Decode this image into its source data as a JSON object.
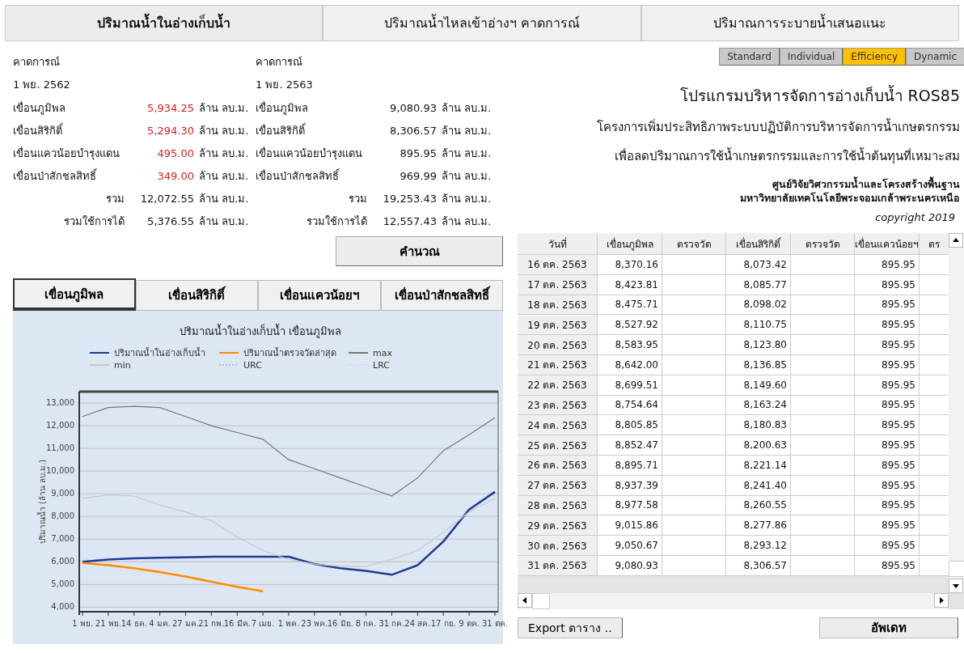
{
  "top_tabs": [
    {
      "label": "ปริมาณน้ำในอ่างเก็บน้ำ",
      "selected": true
    },
    {
      "label": "ปริมาณน้ำไหลเข้าอ่างฯ คาดการณ์",
      "selected": false
    },
    {
      "label": "ปริมาณการระบายน้ำเสนอแนะ",
      "selected": false
    }
  ],
  "forecasts": [
    {
      "heading": "คาดการณ์",
      "date": "1 พย. 2562",
      "dams": [
        {
          "name": "เขื่อนภูมิพล",
          "value": "5,934.25",
          "unit": "ล้าน ลบ.ม.",
          "highlight": true
        },
        {
          "name": "เขื่อนสิริกิติ์",
          "value": "5,294.30",
          "unit": "ล้าน ลบ.ม.",
          "highlight": true
        },
        {
          "name": "เขื่อนแควน้อยบำรุงแดน",
          "value": "495.00",
          "unit": "ล้าน ลบ.ม.",
          "highlight": true
        },
        {
          "name": "เขื่อนป่าสักชลสิทธิ์",
          "value": "349.00",
          "unit": "ล้าน ลบ.ม.",
          "highlight": true
        }
      ],
      "totals": [
        {
          "label": "รวม",
          "value": "12,072.55",
          "unit": "ล้าน ลบ.ม."
        },
        {
          "label": "รวมใช้การได้",
          "value": "5,376.55",
          "unit": "ล้าน ลบ.ม."
        }
      ]
    },
    {
      "heading": "คาดการณ์",
      "date": "1 พย. 2563",
      "dams": [
        {
          "name": "เขื่อนภูมิพล",
          "value": "9,080.93",
          "unit": "ล้าน ลบ.ม.",
          "highlight": false
        },
        {
          "name": "เขื่อนสิริกิติ์",
          "value": "8,306.57",
          "unit": "ล้าน ลบ.ม.",
          "highlight": false
        },
        {
          "name": "เขื่อนแควน้อยบำรุงแดน",
          "value": "895.95",
          "unit": "ล้าน ลบ.ม.",
          "highlight": false
        },
        {
          "name": "เขื่อนป่าสักชลสิทธิ์",
          "value": "969.99",
          "unit": "ล้าน ลบ.ม.",
          "highlight": false
        }
      ],
      "totals": [
        {
          "label": "รวม",
          "value": "19,253.43",
          "unit": "ล้าน ลบ.ม."
        },
        {
          "label": "รวมใช้การได้",
          "value": "12,557.43",
          "unit": "ล้าน ลบ.ม."
        }
      ]
    }
  ],
  "calculate_button": "คำนวณ",
  "mode_buttons": [
    {
      "label": "Standard",
      "selected": false
    },
    {
      "label": "Individual",
      "selected": false
    },
    {
      "label": "Efficiency",
      "selected": true
    },
    {
      "label": "Dynamic",
      "selected": false
    }
  ],
  "program_title": "โปรแกรมบริหารจัดการอ่างเก็บน้ำ ROS85",
  "project_lines": [
    "โครงการเพิ่มประสิทธิภาพระบบปฏิบัติการบริหารจัดการน้ำเกษตรกรรม",
    "เพื่อลดปริมาณการใช้น้ำเกษตรกรรมและการใช้น้ำต้นทุนที่เหมาะสม"
  ],
  "organization_lines": [
    "ศูนย์วิจัยวิศวกรรมน้ำและโครงสร้างพื้นฐาน",
    "มหาวิทยาลัยเทคโนโลยีพระจอมเกล้าพระนครเหนือ"
  ],
  "copyright": "copyright 2019",
  "dam_tabs": [
    {
      "label": "เขื่อนภูมิพล",
      "selected": true
    },
    {
      "label": "เขื่อนสิริกิติ์",
      "selected": false
    },
    {
      "label": "เขื่อนแควน้อยฯ",
      "selected": false
    },
    {
      "label": "เขื่อนป่าสักชลสิทธิ์",
      "selected": false
    }
  ],
  "chart": {
    "chart_data": {
      "type": "line",
      "title": "ปริมาณน้ำในอ่างเก็บน้ำ เขื่อนภูมิพล",
      "ylabel": "ปริมาณน้ำ (ล้าน ลบ.ม.)",
      "categories": [
        "1 พย.",
        "21 พย.",
        "14 ธค.",
        "4 มค.",
        "27 มค.",
        "21 กพ.",
        "16 มีค.",
        "7 เมย.",
        "1 พค.",
        "23 พค.",
        "16 มิย.",
        "8 กค.",
        "31 กค.",
        "24 สค.",
        "17 กย.",
        "9 ตค.",
        "31 ตค."
      ],
      "series": [
        {
          "name": "ปริมาณน้ำในอ่างเก็บน้ำ",
          "color": "#1f3a93",
          "values": [
            6000,
            6100,
            6150,
            6180,
            6200,
            6220,
            6220,
            6220,
            6220,
            5900,
            5720,
            5600,
            5430,
            5850,
            6900,
            8300,
            9080
          ]
        },
        {
          "name": "ปริมาณน้ำตรวจวัดล่าสุด",
          "color": "#ff8c00",
          "values": [
            5950,
            5850,
            5720,
            5550,
            5350,
            5120,
            4900,
            4700,
            null,
            null,
            null,
            null,
            null,
            null,
            null,
            null,
            null
          ]
        },
        {
          "name": "max",
          "color": "#777777",
          "values": [
            12400,
            12800,
            12850,
            12800,
            12400,
            12000,
            11700,
            11400,
            10500,
            10100,
            9700,
            9300,
            8900,
            9700,
            10900,
            11600,
            12350
          ]
        },
        {
          "name": "min",
          "color": "#c8c8c8",
          "values": [
            8800,
            8950,
            8900,
            8500,
            8200,
            7800,
            7100,
            6500,
            6100,
            5900,
            5800,
            5800,
            6100,
            6500,
            7300,
            8200,
            8800
          ]
        },
        {
          "name": "URC",
          "color": "#999999",
          "values": [
            null,
            null,
            null,
            null,
            null,
            null,
            null,
            null,
            null,
            null,
            null,
            null,
            null,
            null,
            null,
            null,
            null
          ]
        },
        {
          "name": "LRC",
          "color": "#bbbbbb",
          "values": [
            null,
            null,
            null,
            null,
            null,
            null,
            null,
            null,
            null,
            null,
            null,
            null,
            null,
            null,
            null,
            null,
            null
          ]
        }
      ],
      "ylim": [
        3800,
        13500
      ],
      "grid": true,
      "legend": "top",
      "yticks": [
        {
          "value": 4000,
          "label": "4,000"
        },
        {
          "value": 5000,
          "label": "5,000"
        },
        {
          "value": 6000,
          "label": "6,000"
        },
        {
          "value": 7000,
          "label": "7,000"
        },
        {
          "value": 8000,
          "label": "8,000"
        },
        {
          "value": 9000,
          "label": "9,000"
        },
        {
          "value": 10000,
          "label": "10,000"
        },
        {
          "value": 11000,
          "label": "11,000"
        },
        {
          "value": 12000,
          "label": "12,000"
        },
        {
          "value": 13000,
          "label": "13,000"
        }
      ]
    }
  },
  "table": {
    "columns": [
      "วันที่",
      "เขื่อนภูมิพล",
      "ตรวจวัด",
      "เขื่อนสิริกิติ์",
      "ตรวจวัด",
      "เขื่อนแควน้อยฯ",
      "ตร"
    ],
    "rows": [
      {
        "date": "16 ตค. 2563",
        "bhumibol": "8,370.16",
        "sirikit": "8,073.42",
        "khwae_noi": "895.95"
      },
      {
        "date": "17 ตค. 2563",
        "bhumibol": "8,423.81",
        "sirikit": "8,085.77",
        "khwae_noi": "895.95"
      },
      {
        "date": "18 ตค. 2563",
        "bhumibol": "8,475.71",
        "sirikit": "8,098.02",
        "khwae_noi": "895.95"
      },
      {
        "date": "19 ตค. 2563",
        "bhumibol": "8,527.92",
        "sirikit": "8,110.75",
        "khwae_noi": "895.95"
      },
      {
        "date": "20 ตค. 2563",
        "bhumibol": "8,583.95",
        "sirikit": "8,123.80",
        "khwae_noi": "895.95"
      },
      {
        "date": "21 ตค. 2563",
        "bhumibol": "8,642.00",
        "sirikit": "8,136.85",
        "khwae_noi": "895.95"
      },
      {
        "date": "22 ตค. 2563",
        "bhumibol": "8,699.51",
        "sirikit": "8,149.60",
        "khwae_noi": "895.95"
      },
      {
        "date": "23 ตค. 2563",
        "bhumibol": "8,754.64",
        "sirikit": "8,163.24",
        "khwae_noi": "895.95"
      },
      {
        "date": "24 ตค. 2563",
        "bhumibol": "8,805.85",
        "sirikit": "8,180.83",
        "khwae_noi": "895.95"
      },
      {
        "date": "25 ตค. 2563",
        "bhumibol": "8,852.47",
        "sirikit": "8,200.63",
        "khwae_noi": "895.95"
      },
      {
        "date": "26 ตค. 2563",
        "bhumibol": "8,895.71",
        "sirikit": "8,221.14",
        "khwae_noi": "895.95"
      },
      {
        "date": "27 ตค. 2563",
        "bhumibol": "8,937.39",
        "sirikit": "8,241.40",
        "khwae_noi": "895.95"
      },
      {
        "date": "28 ตค. 2563",
        "bhumibol": "8,977.58",
        "sirikit": "8,260.55",
        "khwae_noi": "895.95"
      },
      {
        "date": "29 ตค. 2563",
        "bhumibol": "9,015.86",
        "sirikit": "8,277.86",
        "khwae_noi": "895.95"
      },
      {
        "date": "30 ตค. 2563",
        "bhumibol": "9,050.67",
        "sirikit": "8,293.12",
        "khwae_noi": "895.95"
      },
      {
        "date": "31 ตค. 2563",
        "bhumibol": "9,080.93",
        "sirikit": "8,306.57",
        "khwae_noi": "895.95"
      }
    ]
  },
  "export_button": "Export ตาราง ..",
  "update_button": "อัพเดท"
}
